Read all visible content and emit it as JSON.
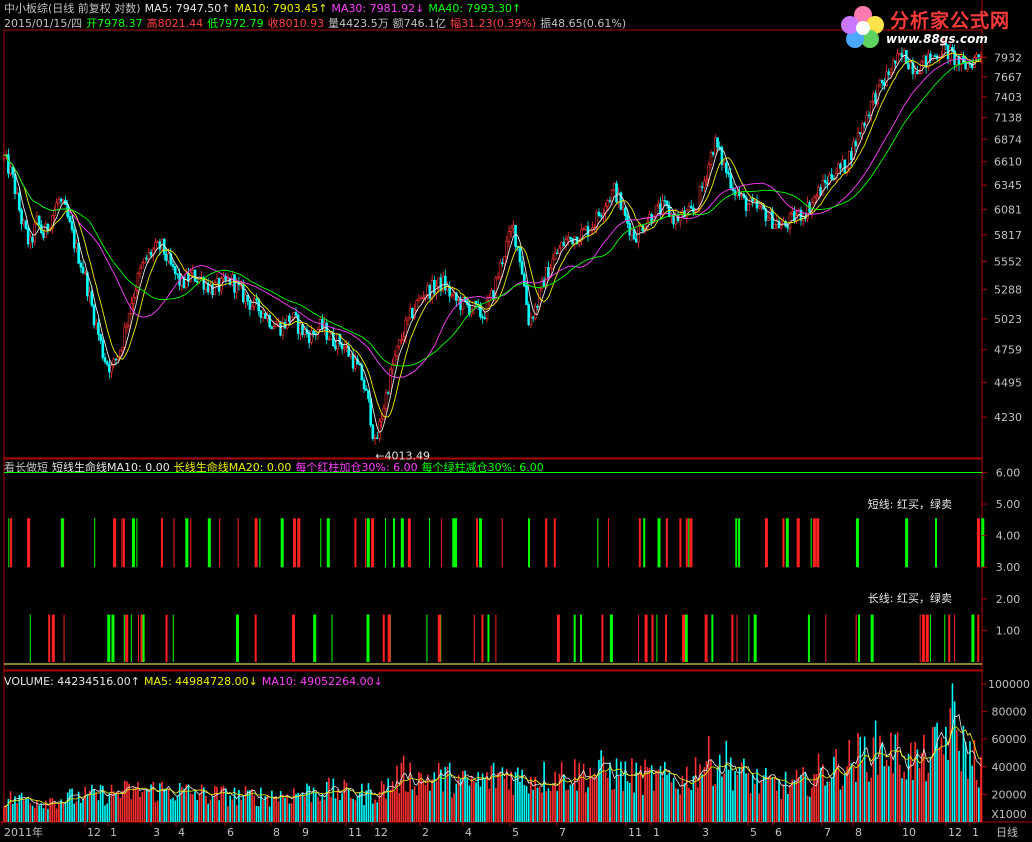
{
  "header": {
    "line1": [
      {
        "text": "中小板综(日线 前复权 对数)",
        "color": "#c0c0c0"
      },
      {
        "text": "MA5: 7947.50↑",
        "color": "#e8e8e8"
      },
      {
        "text": "MA10: 7903.45↑",
        "color": "#f0f000"
      },
      {
        "text": "MA30: 7981.92↓",
        "color": "#ff40ff"
      },
      {
        "text": "MA40: 7993.30↑",
        "color": "#00ff00"
      }
    ],
    "line2": [
      {
        "text": "2015/01/15/四",
        "color": "#c0c0c0"
      },
      {
        "text": "开7978.37",
        "color": "#00ff00"
      },
      {
        "text": "高8021.44",
        "color": "#ff4040"
      },
      {
        "text": "低7972.79",
        "color": "#00ff00"
      },
      {
        "text": "收8010.93",
        "color": "#ff4040"
      },
      {
        "text": "量4423.5万",
        "color": "#c0c0c0"
      },
      {
        "text": "额746.1亿",
        "color": "#c0c0c0"
      },
      {
        "text": "幅31.23(0.39%)",
        "color": "#ff4040"
      },
      {
        "text": "振48.65(0.61%)",
        "color": "#c0c0c0"
      }
    ]
  },
  "logo": {
    "main": "分析家公式网",
    "url": "www.88gs.com"
  },
  "indicator_header": [
    {
      "text": "看长做短",
      "color": "#c0c0c0"
    },
    {
      "text": "短线生命线MA10: 0.00",
      "color": "#e8e8e8"
    },
    {
      "text": "长线生命线MA20: 0.00",
      "color": "#f0f000"
    },
    {
      "text": "每个红柱加仓30%: 6.00",
      "color": "#ff40ff"
    },
    {
      "text": "每个绿柱减仓30%: 6.00",
      "color": "#00ff00"
    }
  ],
  "indicator_labels": {
    "short": "短线: 红买，绿卖",
    "long": "长线: 红买，绿卖"
  },
  "volume_header": [
    {
      "text": "VOLUME: 44234516.00↑",
      "color": "#e8e8e8"
    },
    {
      "text": "MA5: 44984728.00↓",
      "color": "#f0f000"
    },
    {
      "text": "MA10: 49052264.00↓",
      "color": "#ff40ff"
    }
  ],
  "axis_bottom_labels": {
    "unit": "X1000",
    "period": "日线"
  },
  "colors": {
    "up": "#ff3030",
    "down": "#00ffff",
    "ma5": "#e8e8e8",
    "ma10": "#f0f000",
    "ma30": "#ff40ff",
    "ma40": "#00ff00",
    "frame": "#b00000",
    "green_bar": "#00ff00",
    "red_bar": "#ff2020"
  },
  "chart_data": [
    {
      "type": "line",
      "title": "中小板综(日线 前复权 对数)",
      "series": [
        {
          "name": "MA5",
          "values": []
        },
        {
          "name": "MA10",
          "values": []
        },
        {
          "name": "MA30",
          "values": []
        },
        {
          "name": "MA40",
          "values": []
        }
      ],
      "price_path": [
        [
          0,
          6650
        ],
        [
          8,
          6450
        ],
        [
          18,
          5950
        ],
        [
          26,
          5700
        ],
        [
          33,
          5950
        ],
        [
          40,
          5800
        ],
        [
          48,
          6020
        ],
        [
          55,
          6180
        ],
        [
          62,
          6050
        ],
        [
          70,
          5750
        ],
        [
          80,
          5450
        ],
        [
          90,
          5050
        ],
        [
          100,
          4700
        ],
        [
          108,
          4600
        ],
        [
          118,
          4800
        ],
        [
          128,
          5200
        ],
        [
          138,
          5500
        ],
        [
          148,
          5650
        ],
        [
          158,
          5700
        ],
        [
          168,
          5480
        ],
        [
          178,
          5330
        ],
        [
          188,
          5420
        ],
        [
          198,
          5380
        ],
        [
          208,
          5300
        ],
        [
          218,
          5320
        ],
        [
          228,
          5380
        ],
        [
          238,
          5250
        ],
        [
          248,
          5150
        ],
        [
          258,
          5100
        ],
        [
          268,
          5000
        ],
        [
          278,
          4950
        ],
        [
          288,
          5050
        ],
        [
          298,
          4920
        ],
        [
          308,
          4880
        ],
        [
          318,
          4960
        ],
        [
          328,
          4850
        ],
        [
          338,
          4820
        ],
        [
          348,
          4700
        ],
        [
          358,
          4550
        ],
        [
          366,
          4300
        ],
        [
          372,
          4013
        ],
        [
          380,
          4300
        ],
        [
          390,
          4650
        ],
        [
          400,
          4900
        ],
        [
          410,
          5100
        ],
        [
          420,
          5250
        ],
        [
          430,
          5300
        ],
        [
          440,
          5350
        ],
        [
          450,
          5200
        ],
        [
          460,
          5150
        ],
        [
          470,
          5120
        ],
        [
          480,
          5050
        ],
        [
          490,
          5250
        ],
        [
          500,
          5600
        ],
        [
          510,
          5900
        ],
        [
          518,
          5550
        ],
        [
          526,
          5000
        ],
        [
          534,
          5150
        ],
        [
          542,
          5400
        ],
        [
          552,
          5600
        ],
        [
          562,
          5750
        ],
        [
          572,
          5800
        ],
        [
          582,
          5850
        ],
        [
          592,
          5950
        ],
        [
          602,
          6150
        ],
        [
          612,
          6300
        ],
        [
          622,
          6000
        ],
        [
          632,
          5800
        ],
        [
          642,
          5950
        ],
        [
          652,
          6050
        ],
        [
          662,
          6100
        ],
        [
          672,
          5980
        ],
        [
          682,
          6020
        ],
        [
          692,
          6050
        ],
        [
          702,
          6400
        ],
        [
          712,
          6850
        ],
        [
          722,
          6550
        ],
        [
          732,
          6300
        ],
        [
          742,
          6150
        ],
        [
          752,
          6100
        ],
        [
          762,
          6050
        ],
        [
          772,
          5950
        ],
        [
          782,
          5900
        ],
        [
          792,
          6000
        ],
        [
          802,
          6050
        ],
        [
          812,
          6200
        ],
        [
          822,
          6350
        ],
        [
          832,
          6500
        ],
        [
          842,
          6550
        ],
        [
          852,
          6800
        ],
        [
          862,
          7100
        ],
        [
          872,
          7400
        ],
        [
          882,
          7600
        ],
        [
          892,
          7850
        ],
        [
          902,
          7950
        ],
        [
          912,
          7800
        ],
        [
          922,
          7850
        ],
        [
          932,
          7950
        ],
        [
          942,
          8050
        ],
        [
          952,
          7920
        ],
        [
          962,
          7800
        ],
        [
          972,
          7900
        ],
        [
          980,
          8010
        ]
      ],
      "markers": [
        {
          "text": "←4013.49",
          "x": 372,
          "y": 4013.49
        }
      ],
      "yticks": [
        4230,
        4495,
        4759,
        5023,
        5288,
        5552,
        5817,
        6081,
        6345,
        6610,
        6874,
        7138,
        7403,
        7667,
        7932
      ],
      "ylim": [
        4013,
        8050
      ],
      "log_scale": true
    },
    {
      "type": "bar",
      "title": "看长做短",
      "short_line_yticks": [
        3.0,
        4.0,
        5.0,
        6.0
      ],
      "long_line_yticks": [
        1.0,
        2.0
      ],
      "ylim": [
        0,
        6.3
      ]
    },
    {
      "type": "bar",
      "title": "VOLUME",
      "yticks": [
        20000,
        40000,
        60000,
        80000,
        100000
      ],
      "ylim": [
        0,
        105000
      ],
      "volume_envelope": [
        [
          0,
          22000
        ],
        [
          40,
          20000
        ],
        [
          80,
          24000
        ],
        [
          120,
          28000
        ],
        [
          160,
          30000
        ],
        [
          200,
          26000
        ],
        [
          240,
          24000
        ],
        [
          280,
          25000
        ],
        [
          320,
          30000
        ],
        [
          360,
          26000
        ],
        [
          380,
          30000
        ],
        [
          400,
          44000
        ],
        [
          420,
          40000
        ],
        [
          440,
          42000
        ],
        [
          460,
          36000
        ],
        [
          480,
          38000
        ],
        [
          500,
          46000
        ],
        [
          520,
          40000
        ],
        [
          540,
          42000
        ],
        [
          560,
          44000
        ],
        [
          580,
          45000
        ],
        [
          600,
          48000
        ],
        [
          620,
          44000
        ],
        [
          640,
          42000
        ],
        [
          660,
          40000
        ],
        [
          680,
          38000
        ],
        [
          700,
          56000
        ],
        [
          720,
          58000
        ],
        [
          740,
          44000
        ],
        [
          760,
          36000
        ],
        [
          780,
          34000
        ],
        [
          800,
          36000
        ],
        [
          820,
          48000
        ],
        [
          840,
          52000
        ],
        [
          860,
          62000
        ],
        [
          880,
          70000
        ],
        [
          900,
          60000
        ],
        [
          920,
          56000
        ],
        [
          940,
          72000
        ],
        [
          950,
          95000
        ],
        [
          960,
          70000
        ],
        [
          980,
          50000
        ]
      ]
    }
  ],
  "x_axis": {
    "labels": [
      {
        "x": 2,
        "text": "2011年"
      },
      {
        "x": 85,
        "text": "12"
      },
      {
        "x": 108,
        "text": "1"
      },
      {
        "x": 151,
        "text": "3"
      },
      {
        "x": 176,
        "text": "4"
      },
      {
        "x": 225,
        "text": "6"
      },
      {
        "x": 271,
        "text": "8"
      },
      {
        "x": 300,
        "text": "9"
      },
      {
        "x": 346,
        "text": "11"
      },
      {
        "x": 372,
        "text": "12"
      },
      {
        "x": 420,
        "text": "2"
      },
      {
        "x": 463,
        "text": "4"
      },
      {
        "x": 510,
        "text": "5"
      },
      {
        "x": 557,
        "text": "7"
      },
      {
        "x": 626,
        "text": "11"
      },
      {
        "x": 651,
        "text": "1"
      },
      {
        "x": 700,
        "text": "3"
      },
      {
        "x": 748,
        "text": "5"
      },
      {
        "x": 773,
        "text": "6"
      },
      {
        "x": 822,
        "text": "7"
      },
      {
        "x": 853,
        "text": "8"
      },
      {
        "x": 900,
        "text": "10"
      },
      {
        "x": 946,
        "text": "12"
      },
      {
        "x": 970,
        "text": "1"
      }
    ]
  }
}
